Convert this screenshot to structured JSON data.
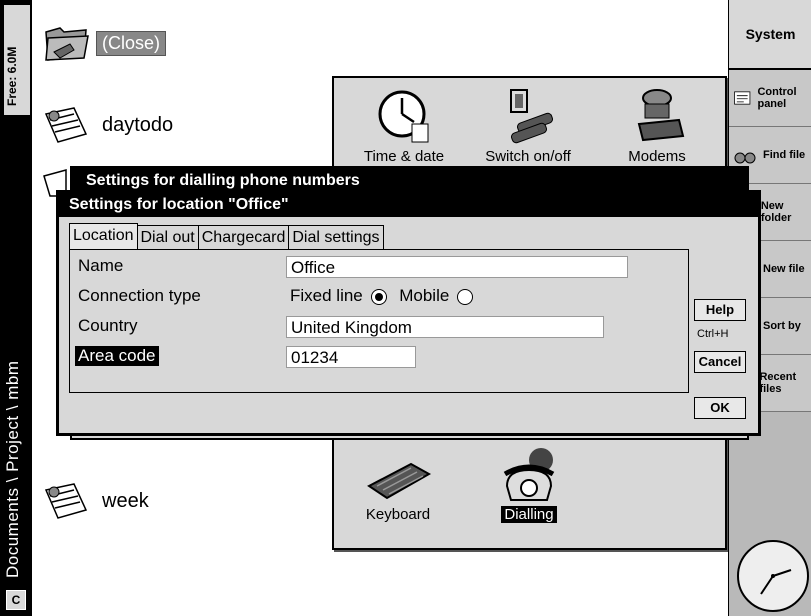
{
  "left_strip": {
    "free": "Free: 6.0M",
    "path": "Documents \\ Project \\ mbm",
    "drive": "C"
  },
  "files": [
    {
      "label": "(Close)",
      "icon": "folder-icon"
    },
    {
      "label": "daytodo",
      "icon": "agenda-file-icon"
    },
    {
      "label": "week",
      "icon": "agenda-file-icon"
    }
  ],
  "control_panel": {
    "items": [
      {
        "label": "Time & date",
        "icon": "clock-icon"
      },
      {
        "label": "Switch on/off",
        "icon": "batteries-icon"
      },
      {
        "label": "Modems",
        "icon": "modem-icon"
      },
      {
        "label": "Keyboard",
        "icon": "keyboard-icon"
      },
      {
        "label": "Dialling",
        "icon": "telephone-icon",
        "selected": true
      }
    ]
  },
  "sidebar": {
    "system": "System",
    "items": [
      {
        "label": "Control panel"
      },
      {
        "label": "Find file"
      },
      {
        "label": "New folder"
      },
      {
        "label": "New file"
      },
      {
        "label": "Sort by"
      },
      {
        "label": "Recent files"
      }
    ]
  },
  "dialog_back": {
    "title": "Settings for dialling phone numbers"
  },
  "dialog": {
    "title": "Settings for location \"Office\"",
    "tabs": [
      "Location",
      "Dial out",
      "Chargecard",
      "Dial settings"
    ],
    "fields": {
      "name_label": "Name",
      "name_value": "Office",
      "connection_label": "Connection type",
      "fixed_line": "Fixed line",
      "mobile": "Mobile",
      "connection_selected": "Fixed line",
      "country_label": "Country",
      "country_value": "United Kingdom",
      "area_label": "Area code",
      "area_value": "01234"
    },
    "buttons": {
      "help": "Help",
      "help_shortcut": "Ctrl+H",
      "cancel": "Cancel",
      "ok": "OK"
    }
  }
}
